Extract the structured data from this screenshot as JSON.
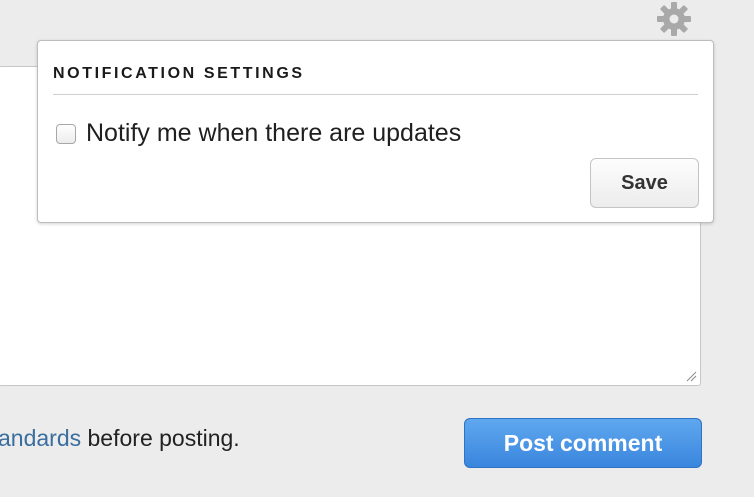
{
  "settings_panel": {
    "title": "NOTIFICATION SETTINGS",
    "notify_label": "Notify me when there are updates",
    "notify_checked": false,
    "save_label": "Save"
  },
  "footer": {
    "link_text": "andards",
    "text_after": " before posting.",
    "post_label": "Post comment"
  },
  "colors": {
    "post_button": "#3a86de",
    "link": "#3a6e9e"
  }
}
